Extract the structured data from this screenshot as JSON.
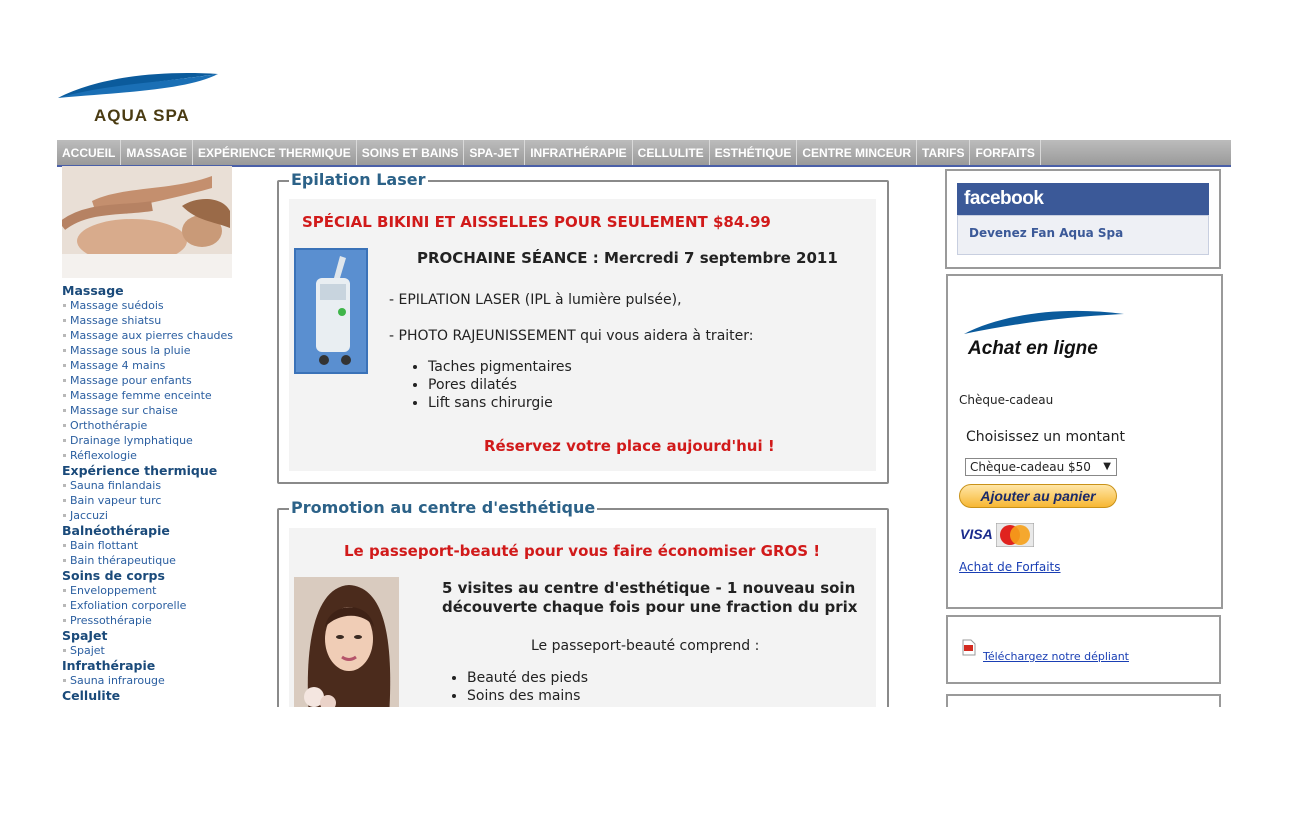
{
  "header": {
    "logo_text": "AQUA SPA"
  },
  "nav": [
    "ACCUEIL",
    "MASSAGE",
    "EXPÉRIENCE THERMIQUE",
    "SOINS ET BAINS",
    "SPA-JET",
    "INFRATHÉRAPIE",
    "CELLULITE",
    "ESTHÉTIQUE",
    "CENTRE MINCEUR",
    "TARIFS",
    "FORFAITS"
  ],
  "sidebar": [
    {
      "category": "Massage",
      "items": [
        "Massage suédois",
        "Massage shiatsu",
        "Massage aux pierres chaudes",
        "Massage sous la pluie",
        "Massage 4 mains",
        "Massage pour enfants",
        "Massage femme enceinte",
        "Massage sur chaise",
        "Orthothérapie",
        "Drainage lymphatique",
        "Réflexologie"
      ]
    },
    {
      "category": "Expérience thermique",
      "items": [
        "Sauna finlandais",
        "Bain vapeur turc",
        "Jaccuzi"
      ]
    },
    {
      "category": "Balnéothérapie",
      "items": [
        "Bain flottant",
        "Bain thérapeutique"
      ]
    },
    {
      "category": "Soins de corps",
      "items": [
        "Enveloppement",
        "Exfoliation corporelle",
        "Pressothérapie"
      ]
    },
    {
      "category": "SpaJet",
      "items": [
        "Spajet"
      ]
    },
    {
      "category": "Infrathérapie",
      "items": [
        "Sauna infrarouge"
      ]
    },
    {
      "category": "Cellulite",
      "items": []
    }
  ],
  "laser": {
    "legend": "Epilation Laser",
    "promo": "SPÉCIAL BIKINI ET AISSELLES POUR SEULEMENT $84.99",
    "next_session": "PROCHAINE SÉANCE : Mercredi 7 septembre 2011",
    "line1": "- EPILATION LASER (IPL à lumière pulsée),",
    "line2": "- PHOTO RAJEUNISSEMENT qui vous aidera à traiter:",
    "bullets": [
      "Taches pigmentaires",
      "Pores dilatés",
      "Lift sans chirurgie"
    ],
    "cta": "Réservez votre place aujourd'hui !"
  },
  "esthetic": {
    "legend": "Promotion au centre d'esthétique",
    "promo": "Le passeport-beauté pour vous faire économiser GROS !",
    "heading_line1": "5 visites au centre d'esthétique - 1 nouveau soin",
    "heading_line2": "découverte chaque fois pour une fraction du prix",
    "includes": "Le passeport-beauté comprend :",
    "bullets": [
      "Beauté des pieds",
      "Soins des mains"
    ]
  },
  "facebook": {
    "brand": "facebook",
    "cta": "Devenez Fan Aqua Spa"
  },
  "shop": {
    "title": "Achat en ligne",
    "product": "Chèque-cadeau",
    "choose_label": "Choisissez un montant",
    "selected_amount": "Chèque-cadeau $50",
    "add_button": "Ajouter au panier",
    "visa": "VISA",
    "mastercard": "MasterCard",
    "forfaits_link": "Achat de Forfaits"
  },
  "brochure": {
    "link": "Téléchargez notre dépliant"
  },
  "colors": {
    "nav_bg": "#a8a8a8",
    "accent_blue": "#2c6288",
    "promo_red": "#d11a1a",
    "facebook_blue": "#3b5998"
  }
}
